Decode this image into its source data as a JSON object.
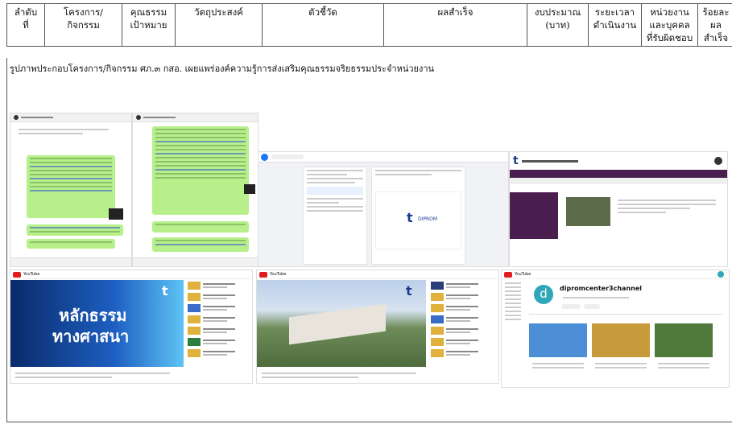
{
  "table": {
    "headers": [
      {
        "l1": "ลำดับ",
        "l2": "ที่",
        "l3": ""
      },
      {
        "l1": "โครงการ/",
        "l2": "กิจกรรม",
        "l3": ""
      },
      {
        "l1": "คุณธรรม",
        "l2": "เป้าหมาย",
        "l3": ""
      },
      {
        "l1": "วัตถุประสงค์",
        "l2": "",
        "l3": ""
      },
      {
        "l1": "ตัวชี้วัด",
        "l2": "",
        "l3": ""
      },
      {
        "l1": "ผลสำเร็จ",
        "l2": "",
        "l3": ""
      },
      {
        "l1": "งบประมาณ",
        "l2": "(บาท)",
        "l3": ""
      },
      {
        "l1": "ระยะเวลา",
        "l2": "ดำเนินงาน",
        "l3": ""
      },
      {
        "l1": "หน่วยงาน",
        "l2": "และบุคคล",
        "l3": "ที่รับผิดชอบ"
      },
      {
        "l1": "ร้อยละ",
        "l2": "ผลสำเร็จ",
        "l3": ""
      }
    ]
  },
  "caption": "รูปภาพประกอบโครงการ/กิจกรรม ศภ.๓ กสอ. เผยแพร่องค์ความรู้การส่งเสริมคุณธรรมจริยธรรมประจำหน่วยงาน",
  "screenshots": {
    "youtube1_title": "หลักธรรม",
    "youtube1_subtitle": "ทางศาสนา",
    "channel_name": "dipromcenter3channel",
    "channel_initial": "d",
    "logo_text": "DIPROM",
    "youtube_label": "YouTube"
  },
  "colors": {
    "chat_bubble": "#b7ef8a",
    "website_purple": "#4a1f4f",
    "facebook_blue": "#1877f2",
    "youtube_red": "#e21c1c"
  }
}
